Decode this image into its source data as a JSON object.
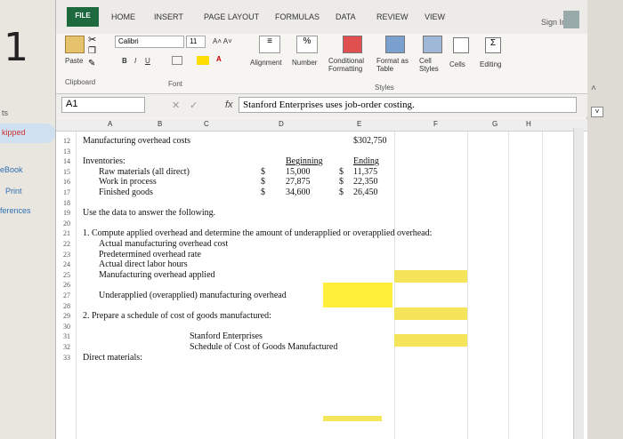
{
  "left_margin": {
    "big_number": "1",
    "nav": [
      "ts",
      "kipped",
      "eBook",
      "Print",
      "ferences"
    ]
  },
  "ribbon": {
    "tabs": [
      "FILE",
      "HOME",
      "INSERT",
      "PAGE LAYOUT",
      "FORMULAS",
      "DATA",
      "REVIEW",
      "VIEW"
    ],
    "sign_in": "Sign In",
    "font_name": "Calibri",
    "font_size": "11",
    "paste": "Paste",
    "clipboard": "Clipboard",
    "font": "Font",
    "bold": "B",
    "italic": "I",
    "underline": "U",
    "alignment": "Alignment",
    "number": "Number",
    "percent": "%",
    "conditional": "Conditional",
    "formatting": "Formatting",
    "format_as": "Format as",
    "table": "Table",
    "cell": "Cell",
    "styles_btn": "Styles",
    "styles_group": "Styles",
    "cells": "Cells",
    "editing": "Editing"
  },
  "formula_bar": {
    "name_box": "A1",
    "fx": "fx",
    "content": "Stanford Enterprises uses job-order costing."
  },
  "columns": [
    "A",
    "B",
    "C",
    "D",
    "E",
    "F",
    "G",
    "H"
  ],
  "rows": [
    {
      "n": "12",
      "a": "Manufacturing overhead costs",
      "e": "$302,750"
    },
    {
      "n": "13"
    },
    {
      "n": "14",
      "a": "Inventories:",
      "d": "Beginning",
      "e": "Ending"
    },
    {
      "n": "15",
      "b": "Raw materials (all direct)",
      "ds": "$",
      "d": "15,000",
      "es": "$",
      "e": "11,375"
    },
    {
      "n": "16",
      "b": "Work in process",
      "ds": "$",
      "d": "27,875",
      "es": "$",
      "e": "22,350"
    },
    {
      "n": "17",
      "b": "Finished goods",
      "ds": "$",
      "d": "34,600",
      "es": "$",
      "e": "26,450"
    },
    {
      "n": "18"
    },
    {
      "n": "19",
      "a": "Use the data to answer the following."
    },
    {
      "n": "20"
    },
    {
      "n": "21",
      "a": "1. Compute applied overhead and determine the amount of underapplied or overapplied overhead:"
    },
    {
      "n": "22",
      "b": "Actual manufacturing overhead cost"
    },
    {
      "n": "23",
      "b": "Predetermined overhead rate"
    },
    {
      "n": "24",
      "b": "Actual direct labor hours"
    },
    {
      "n": "25",
      "b": "Manufacturing overhead applied"
    },
    {
      "n": "26"
    },
    {
      "n": "27",
      "b": "Underapplied (overapplied) manufacturing overhead"
    },
    {
      "n": "28"
    },
    {
      "n": "29",
      "a": "2. Prepare a schedule of cost of goods manufactured:"
    },
    {
      "n": "30"
    },
    {
      "n": "31",
      "c": "Stanford Enterprises"
    },
    {
      "n": "32",
      "c": "Schedule of Cost of Goods Manufactured"
    },
    {
      "n": "33",
      "a": "Direct materials:"
    }
  ]
}
